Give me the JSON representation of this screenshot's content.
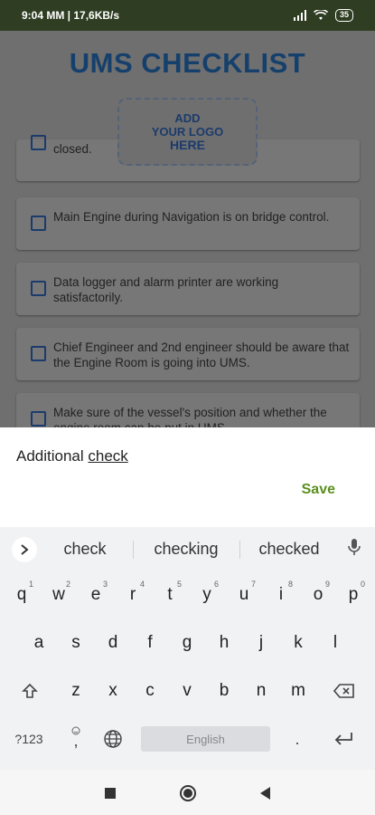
{
  "status_bar": {
    "time_and_speed": "9:04 MM | 17,6KB/s",
    "battery": "35"
  },
  "app": {
    "title": "UMS CHECKLIST",
    "logo": {
      "line1": "ADD",
      "line2": "YOUR LOGO",
      "line3": "HERE"
    },
    "items": [
      {
        "text": "closed."
      },
      {
        "text": "Main Engine during Navigation is on bridge control."
      },
      {
        "text": "Data logger and alarm printer are working satisfactorily."
      },
      {
        "text": "Chief Engineer and 2nd engineer should be aware that the Engine Room is going into UMS."
      },
      {
        "text": "Make sure of the vessel's position and whether the engine room can be put in UMS."
      }
    ]
  },
  "sheet": {
    "input_prefix": "Additional ",
    "input_word": "check",
    "save_label": "Save"
  },
  "keyboard": {
    "suggestions": [
      "check",
      "checking",
      "checked"
    ],
    "row1": [
      "q",
      "w",
      "e",
      "r",
      "t",
      "y",
      "u",
      "i",
      "o",
      "p"
    ],
    "row1_hints": [
      "1",
      "2",
      "3",
      "4",
      "5",
      "6",
      "7",
      "8",
      "9",
      "0"
    ],
    "row2": [
      "a",
      "s",
      "d",
      "f",
      "g",
      "h",
      "j",
      "k",
      "l"
    ],
    "row3": [
      "z",
      "x",
      "c",
      "v",
      "b",
      "n",
      "m"
    ],
    "symbols_label": "?123",
    "comma": ",",
    "period": ".",
    "space_label": "English"
  },
  "icons": {
    "chevron": "chevron-right-icon",
    "mic": "microphone-icon",
    "shift": "shift-icon",
    "backspace": "backspace-icon",
    "globe": "globe-icon",
    "emoji": "emoji-icon",
    "enter": "enter-icon",
    "nav_recents": "square-icon",
    "nav_home": "circle-icon",
    "nav_back": "back-triangle-icon"
  },
  "colors": {
    "status_bar": "#2f3d22",
    "title": "#16406c",
    "save": "#5c8f1f",
    "overlay": "#6f6f6f"
  }
}
